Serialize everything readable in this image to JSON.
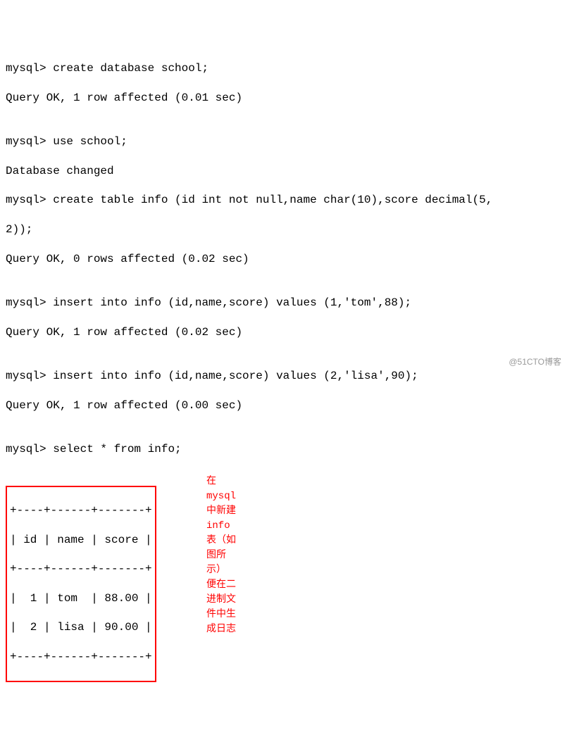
{
  "terminal": {
    "prompt": "mysql>",
    "lines": {
      "l1": "mysql> create database school;",
      "l2": "Query OK, 1 row affected (0.01 sec)",
      "l3": "",
      "l4": "mysql> use school;",
      "l5": "Database changed",
      "l6": "mysql> create table info (id int not null,name char(10),score decimal(5,",
      "l7": "2));",
      "l8": "Query OK, 0 rows affected (0.02 sec)",
      "l9": "",
      "l10": "mysql> insert into info (id,name,score) values (1,'tom',88);",
      "l11": "Query OK, 1 row affected (0.02 sec)",
      "l12": "",
      "l13": "mysql> insert into info (id,name,score) values (2,'lisa',90);",
      "l14": "Query OK, 1 row affected (0.00 sec)",
      "l15": "",
      "l16": "mysql> select * from info;"
    }
  },
  "table": {
    "border_top": "+----+------+-------+",
    "header": "| id | name | score |",
    "border_mid": "+----+------+-------+",
    "row1": "|  1 | tom  | 88.00 |",
    "row2": "|  2 | lisa | 90.00 |",
    "border_bot": "+----+------+-------+"
  },
  "annotation": {
    "line1": "在mysql中新建info表（如图所示）",
    "line2": "便在二进制文件中生成日志"
  },
  "watermark": "@51CTO博客",
  "chart_data": {
    "type": "table",
    "title": "info",
    "columns": [
      "id",
      "name",
      "score"
    ],
    "rows": [
      {
        "id": 1,
        "name": "tom",
        "score": 88.0
      },
      {
        "id": 2,
        "name": "lisa",
        "score": 90.0
      }
    ]
  }
}
